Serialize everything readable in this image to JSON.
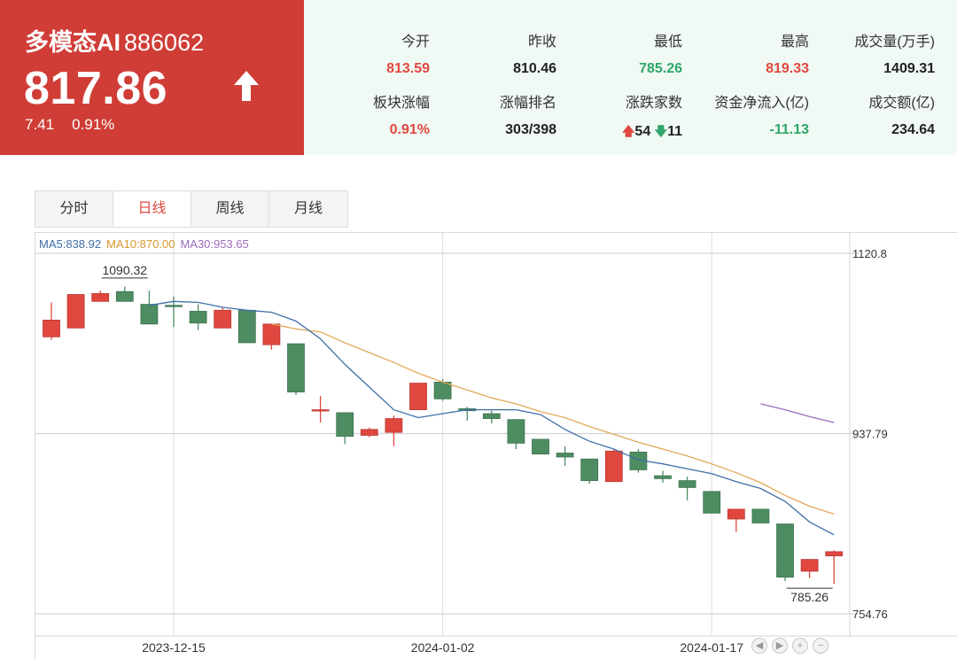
{
  "header": {
    "name": "多模态AI",
    "code": "886062",
    "price": "817.86",
    "change": "7.41",
    "change_pct": "0.91%"
  },
  "stats": [
    {
      "label": "今开",
      "value": "813.59",
      "color": "red"
    },
    {
      "label": "昨收",
      "value": "810.46",
      "color": "black"
    },
    {
      "label": "最低",
      "value": "785.26",
      "color": "green"
    },
    {
      "label": "最高",
      "value": "819.33",
      "color": "red"
    },
    {
      "label": "成交量(万手)",
      "value": "1409.31",
      "color": "black"
    },
    {
      "label": "板块涨幅",
      "value": "0.91%",
      "color": "red"
    },
    {
      "label": "涨幅排名",
      "value": "303/398",
      "color": "black"
    },
    {
      "label": "涨跌家数",
      "up": "54",
      "down": "11"
    },
    {
      "label": "资金净流入(亿)",
      "value": "-11.13",
      "color": "green"
    },
    {
      "label": "成交额(亿)",
      "value": "234.64",
      "color": "black"
    }
  ],
  "tabs": [
    "分时",
    "日线",
    "周线",
    "月线"
  ],
  "active_tab": "日线",
  "ma_legend": {
    "ma5": "MA5:838.92",
    "ma10": "MA10:870.00",
    "ma30": "MA30:953.65"
  },
  "colors": {
    "up": "#e0473f",
    "down": "#4e8c62",
    "header_bg": "#cf3d36",
    "stats_bg": "#f0f9f3",
    "ma5": "#3f6fa8",
    "ma10": "#e3a857",
    "ma30": "#9b6dbd"
  },
  "nav_icons": [
    "arrow-left-icon",
    "arrow-right-icon",
    "zoom-in-icon",
    "zoom-out-icon"
  ],
  "chart_data": {
    "type": "candlestick",
    "y_ticks": [
      "1120.8",
      "937.79",
      "754.76"
    ],
    "ylim": [
      754.76,
      1120.8
    ],
    "x_ticks": [
      {
        "index": 5,
        "label": "2023-12-15"
      },
      {
        "index": 16,
        "label": "2024-01-02"
      },
      {
        "index": 27,
        "label": "2024-01-17"
      }
    ],
    "annotations": [
      {
        "index": 3,
        "value": 1090.32,
        "label": "1090.32"
      },
      {
        "index": 31,
        "value": 785.26,
        "label": "785.26"
      }
    ],
    "candles": [
      {
        "o": 1036,
        "c": 1053,
        "h": 1071,
        "l": 1033
      },
      {
        "o": 1045,
        "c": 1079,
        "h": 1079,
        "l": 1045
      },
      {
        "o": 1072,
        "c": 1080,
        "h": 1083,
        "l": 1072
      },
      {
        "o": 1082,
        "c": 1072,
        "h": 1087,
        "l": 1072
      },
      {
        "o": 1069,
        "c": 1049,
        "h": 1083,
        "l": 1049
      },
      {
        "o": 1068,
        "c": 1067,
        "h": 1077,
        "l": 1046
      },
      {
        "o": 1062,
        "c": 1050,
        "h": 1069,
        "l": 1043
      },
      {
        "o": 1045,
        "c": 1063,
        "h": 1066,
        "l": 1045
      },
      {
        "o": 1063,
        "c": 1030,
        "h": 1063,
        "l": 1030
      },
      {
        "o": 1028,
        "c": 1049,
        "h": 1049,
        "l": 1023
      },
      {
        "o": 1029,
        "c": 980,
        "h": 1029,
        "l": 977
      },
      {
        "o": 961,
        "c": 962,
        "h": 976,
        "l": 949
      },
      {
        "o": 959,
        "c": 935,
        "h": 959,
        "l": 927
      },
      {
        "o": 936,
        "c": 942,
        "h": 944,
        "l": 934
      },
      {
        "o": 939,
        "c": 953,
        "h": 956,
        "l": 925
      },
      {
        "o": 962,
        "c": 989,
        "h": 989,
        "l": 962
      },
      {
        "o": 990,
        "c": 973,
        "h": 993,
        "l": 971
      },
      {
        "o": 963,
        "c": 961,
        "h": 965,
        "l": 951
      },
      {
        "o": 958,
        "c": 953,
        "h": 961,
        "l": 948
      },
      {
        "o": 952,
        "c": 928,
        "h": 952,
        "l": 922
      },
      {
        "o": 932,
        "c": 917,
        "h": 932,
        "l": 917
      },
      {
        "o": 918,
        "c": 914,
        "h": 925,
        "l": 905
      },
      {
        "o": 912,
        "c": 890,
        "h": 912,
        "l": 887
      },
      {
        "o": 889,
        "c": 920,
        "h": 922,
        "l": 889
      },
      {
        "o": 919,
        "c": 901,
        "h": 922,
        "l": 898
      },
      {
        "o": 895,
        "c": 892,
        "h": 900,
        "l": 888
      },
      {
        "o": 890,
        "c": 883,
        "h": 894,
        "l": 870
      },
      {
        "o": 879,
        "c": 857,
        "h": 879,
        "l": 857
      },
      {
        "o": 851,
        "c": 861,
        "h": 861,
        "l": 838
      },
      {
        "o": 861,
        "c": 847,
        "h": 861,
        "l": 847
      },
      {
        "o": 846,
        "c": 792,
        "h": 846,
        "l": 788
      },
      {
        "o": 798,
        "c": 810,
        "h": 810,
        "l": 791
      },
      {
        "o": 813.59,
        "c": 817.86,
        "h": 819.33,
        "l": 785.26
      }
    ],
    "ma5": [
      null,
      null,
      null,
      null,
      1068,
      1072,
      1071,
      1066,
      1063,
      1061,
      1052,
      1034,
      1008,
      985,
      962,
      954,
      958,
      962,
      962,
      962,
      957,
      942,
      930,
      922,
      911,
      907,
      902,
      897,
      889,
      882,
      869,
      848,
      835
    ],
    "ma10": [
      null,
      null,
      null,
      null,
      null,
      null,
      null,
      null,
      null,
      1049,
      1044,
      1041,
      1030,
      1020,
      1010,
      999,
      990,
      982,
      974,
      968,
      960,
      954,
      945,
      937,
      929,
      922,
      915,
      907,
      898,
      888,
      875,
      864,
      856
    ],
    "ma30": [
      null,
      null,
      null,
      null,
      null,
      null,
      null,
      null,
      null,
      null,
      null,
      null,
      null,
      null,
      null,
      null,
      null,
      null,
      null,
      null,
      null,
      null,
      null,
      null,
      null,
      null,
      null,
      null,
      null,
      968,
      962,
      955,
      949
    ]
  }
}
